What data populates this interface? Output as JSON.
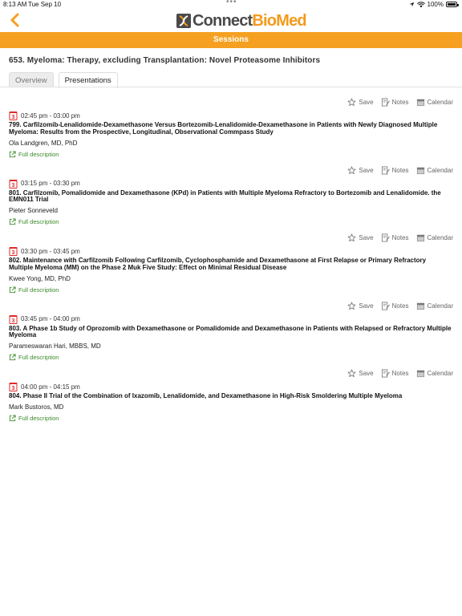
{
  "status_bar": {
    "time": "8:13 AM",
    "date": "Tue Sep 10",
    "battery": "100%"
  },
  "nav": {
    "logo_part1": "Connect",
    "logo_part2": "BioMed",
    "accent_color": "#f5a020"
  },
  "header": {
    "section_label": "Sessions"
  },
  "session": {
    "title": "653. Myeloma: Therapy, excluding Transplantation: Novel Proteasome Inhibitors"
  },
  "tabs": [
    {
      "label": "Overview",
      "active": false
    },
    {
      "label": "Presentations",
      "active": true
    }
  ],
  "action_labels": {
    "save": "Save",
    "notes": "Notes",
    "calendar": "Calendar"
  },
  "full_description_label": "Full description",
  "calendar_badge_day": "3",
  "presentations": [
    {
      "time": "02:45 pm - 03:00 pm",
      "title": "799. Carfilzomib-Lenalidomide-Dexamethasone Versus Bortezomib-Lenalidomide-Dexamethasone in Patients with Newly Diagnosed Multiple Myeloma: Results from the Prospective, Longitudinal, Observational Commpass Study",
      "presenter": "Ola Landgren, MD, PhD"
    },
    {
      "time": "03:15 pm - 03:30 pm",
      "title": "801. Carfilzomib, Pomalidomide and Dexamethasone (KPd) in Patients with Multiple Myeloma Refractory to Bortezomib and Lenalidomide. the EMN011 Trial",
      "presenter": "Pieter Sonneveld"
    },
    {
      "time": "03:30 pm - 03:45 pm",
      "title": "802. Maintenance with Carfilzomib Following Carfilzomib, Cyclophosphamide and Dexamethasone at First Relapse or Primary Refractory Multiple Myeloma (MM) on the Phase 2 Muk Five Study: Effect on Minimal Residual Disease",
      "presenter": "Kwee Yong, MD, PhD"
    },
    {
      "time": "03:45 pm - 04:00 pm",
      "title": "803. A Phase 1b Study of Oprozomib with Dexamethasone or Pomalidomide and Dexamethasone in Patients with Relapsed or Refractory Multiple Myeloma",
      "presenter": "Parameswaran Hari, MBBS, MD"
    },
    {
      "time": "04:00 pm - 04:15 pm",
      "title": "804. Phase II Trial of the Combination of Ixazomib, Lenalidomide, and Dexamethasone in High-Risk Smoldering Multiple Myeloma",
      "presenter": "Mark Bustoros, MD"
    }
  ]
}
